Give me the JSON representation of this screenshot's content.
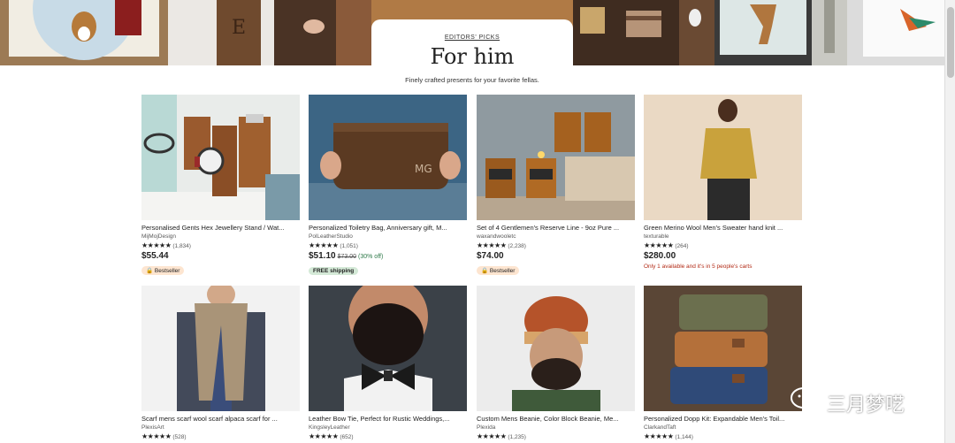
{
  "section": {
    "eyebrow": "EDITORS' PICKS",
    "title": "For him",
    "subtitle": "Finely crafted presents for your favorite fellas."
  },
  "products": [
    {
      "title": "Personalised Gents Hex Jewellery Stand / Wat...",
      "shop": "MijMojDesign",
      "stars": "★★★★★",
      "count": "(1,834)",
      "price": "$55.44",
      "badge": "Bestseller"
    },
    {
      "title": "Personalized Toiletry Bag, Anniversary gift, M...",
      "shop": "PolLeatherStudio",
      "stars": "★★★★★",
      "count": "(1,051)",
      "price": "$51.10",
      "orig": "$73.00",
      "discount": "(30% off)",
      "shipping": "FREE shipping"
    },
    {
      "title": "Set of 4 Gentlemen's Reserve Line - 9oz Pure ...",
      "shop": "waxandwooletc",
      "stars": "★★★★★",
      "count": "(2,238)",
      "price": "$74.00",
      "badge": "Bestseller"
    },
    {
      "title": "Green Merino Wool Men's Sweater hand knit ...",
      "shop": "texturable",
      "stars": "★★★★★",
      "count": "(264)",
      "price": "$280.00",
      "scarcity": "Only 1 available and it's in 5 people's carts"
    },
    {
      "title": "Scarf mens scarf wool scarf alpaca scarf for ...",
      "shop": "PlexisArt",
      "stars": "★★★★★",
      "count": "(528)"
    },
    {
      "title": "Leather Bow Tie, Perfect for Rustic Weddings,...",
      "shop": "KingsleyLeather",
      "stars": "★★★★★",
      "count": "(652)"
    },
    {
      "title": "Custom Mens Beanie, Color Block Beanie, Me...",
      "shop": "Plexida",
      "stars": "★★★★★",
      "count": "(1,235)"
    },
    {
      "title": "Personalized Dopp Kit: Expandable Men's Toil...",
      "shop": "ClarkandTaft",
      "stars": "★★★★★",
      "count": "(1,144)"
    }
  ],
  "watermark": "三月梦呓",
  "colors": {
    "accent_green": "#2f7a4a",
    "badge_orange": "#fde5d0",
    "scarcity_red": "#b22a15"
  }
}
